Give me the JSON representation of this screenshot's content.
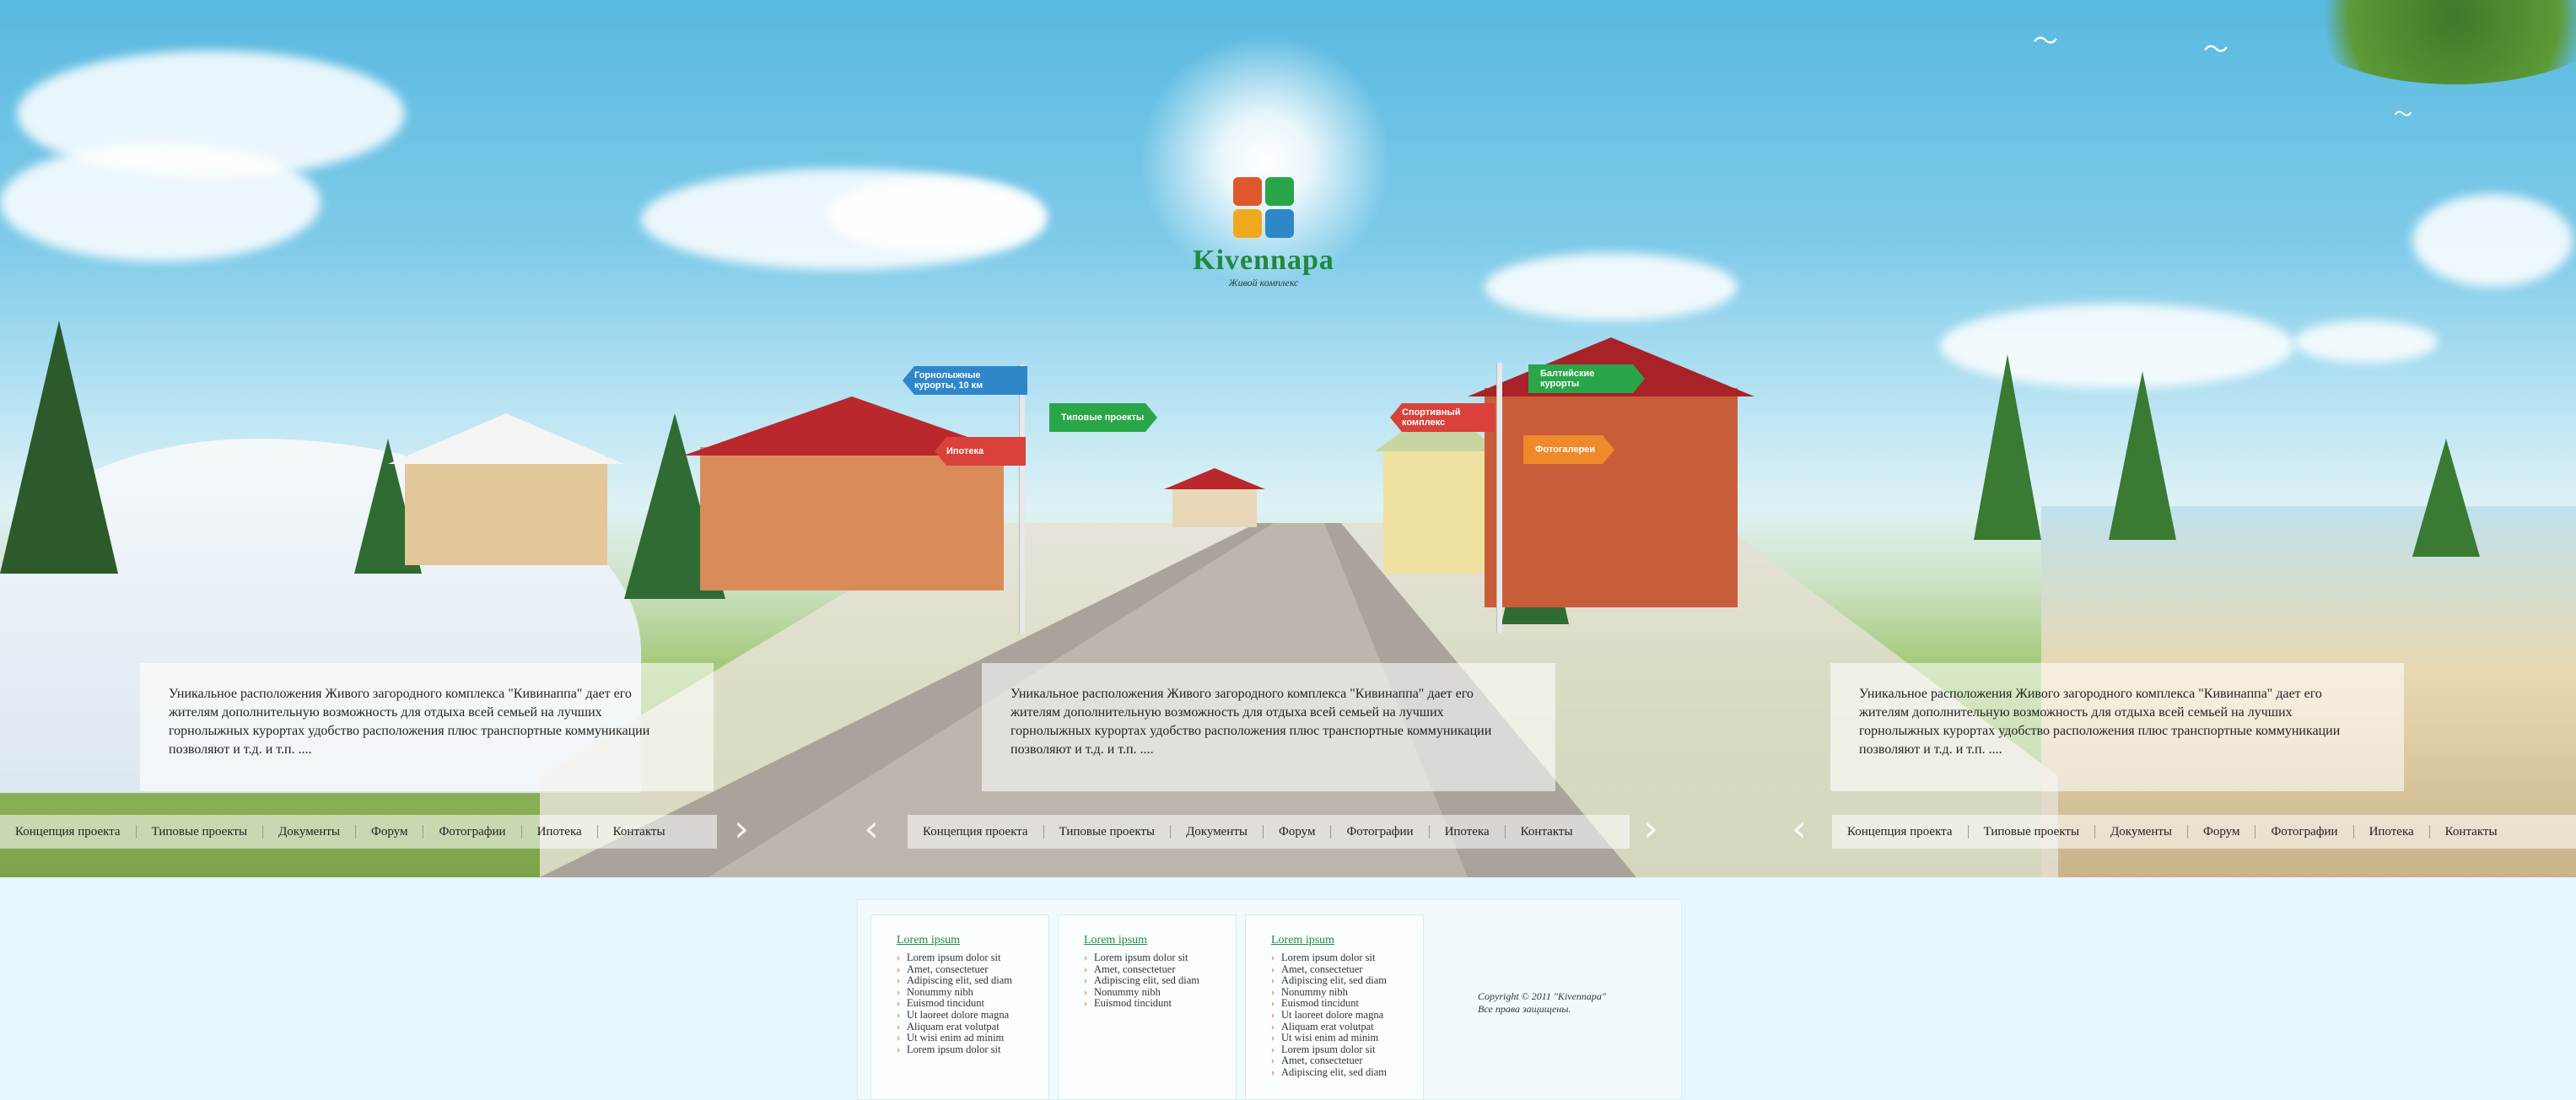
{
  "brand": {
    "name": "Kivennapa",
    "tagline": "Живой комплекс"
  },
  "signs": {
    "left_top": "Горнолыжные курорты, 10 км",
    "left_mid": "Типовые проекты",
    "left_bottom": "Ипотека",
    "right_top": "Балтийские курорты",
    "right_mid": "Спортивный комплекс",
    "right_bottom": "Фотогалереи"
  },
  "panels": [
    {
      "text": "Уникальное расположения Живого загородного комплекса \"Кивинаппа\" дает его жителям дополнительную возможность для отдыха всей семьей на лучших горнолыжных курортах удобство расположения плюс транспортные коммуникации позволяют  и т.д.  и т.п.  ...."
    },
    {
      "text": "Уникальное расположения Живого загородного комплекса \"Кивинаппа\" дает его жителям дополнительную возможность для отдыха всей семьей на лучших горнолыжных курортах удобство расположения плюс транспортные коммуникации позволяют  и т.д.  и т.п.  ...."
    },
    {
      "text": "Уникальное расположения Живого загородного комплекса \"Кивинаппа\" дает его жителям дополнительную возможность для отдыха всей семьей на лучших горнолыжных курортах удобство расположения плюс транспортные коммуникации позволяют  и т.д.  и т.п.  ...."
    }
  ],
  "nav": [
    "Концепция проекта",
    "Типовые проекты",
    "Документы",
    "Форум",
    "Фотографии",
    "Ипотека",
    "Контакты"
  ],
  "footer": {
    "columns": [
      {
        "title": "Lorem ipsum",
        "items": [
          "Lorem ipsum dolor sit",
          "Amet, consectetuer",
          "Adipiscing elit, sed diam",
          "Nonummy nibh",
          "Euismod tincidunt",
          "Ut laoreet dolore magna",
          "Aliquam erat volutpat",
          "Ut wisi enim ad minim",
          "Lorem ipsum dolor sit"
        ]
      },
      {
        "title": "Lorem ipsum",
        "items": [
          "Lorem ipsum dolor sit",
          "Amet, consectetuer",
          "Adipiscing elit, sed diam",
          "Nonummy nibh",
          "Euismod tincidunt"
        ]
      },
      {
        "title": "Lorem ipsum",
        "items": [
          "Lorem ipsum dolor sit",
          "Amet, consectetuer",
          "Adipiscing elit, sed diam",
          "Nonummy nibh",
          "Euismod tincidunt",
          "Ut laoreet dolore magna",
          "Aliquam erat volutpat",
          "Ut wisi enim ad minim",
          "Lorem ipsum dolor sit",
          "Amet, consectetuer",
          "Adipiscing elit, sed diam"
        ]
      }
    ],
    "copyright_line1": "Copyright © 2011 \"Kivennapa\"",
    "copyright_line2": "Все права защищены."
  },
  "colors": {
    "brand_green": "#1f8a3e",
    "sign_blue": "#2f86c9",
    "sign_green": "#2aa64a",
    "sign_red": "#d9413a",
    "sign_orange": "#ee8a2a",
    "bullet_orange": "#e2872a"
  },
  "icons": {
    "prev": "chevron-left-icon",
    "next": "chevron-right-icon"
  }
}
